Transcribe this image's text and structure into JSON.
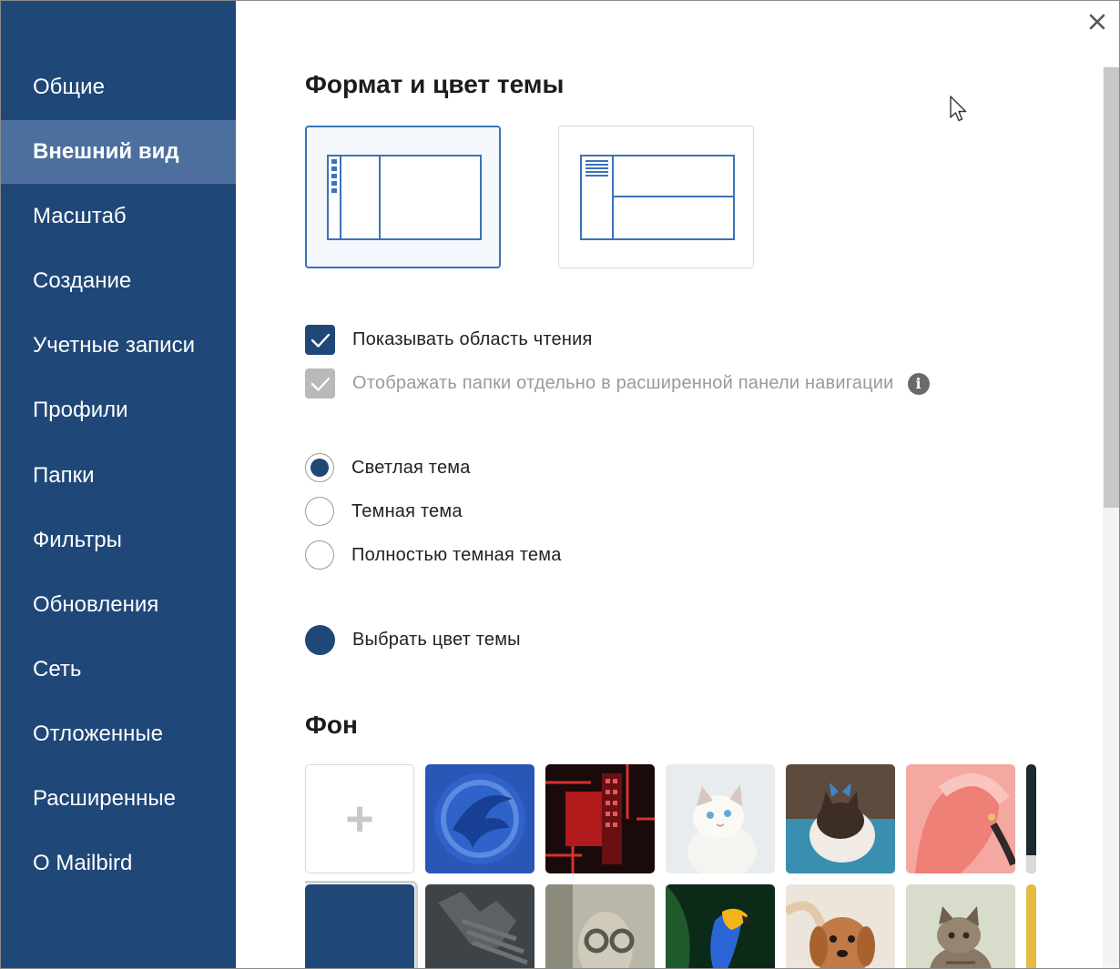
{
  "window": {
    "close_label": "✕"
  },
  "sidebar": {
    "items": [
      {
        "label": "Общие"
      },
      {
        "label": "Внешний вид",
        "active": true
      },
      {
        "label": "Масштаб"
      },
      {
        "label": "Создание"
      },
      {
        "label": "Учетные записи"
      },
      {
        "label": "Профили"
      },
      {
        "label": "Папки"
      },
      {
        "label": "Фильтры"
      },
      {
        "label": "Обновления"
      },
      {
        "label": "Сеть"
      },
      {
        "label": "Отложенные"
      },
      {
        "label": "Расширенные"
      },
      {
        "label": "О Mailbird"
      }
    ]
  },
  "main": {
    "title": "Формат и цвет темы",
    "layouts": [
      {
        "name": "vertical-split",
        "selected": true
      },
      {
        "name": "horizontal-split",
        "selected": false
      }
    ],
    "checkboxes": [
      {
        "label": "Показывать область чтения",
        "checked": true,
        "disabled": false
      },
      {
        "label": "Отображать папки отдельно в расширенной панели навигации",
        "checked": true,
        "disabled": true
      }
    ],
    "themes": [
      {
        "label": "Светлая тема",
        "selected": true
      },
      {
        "label": "Темная тема",
        "selected": false
      },
      {
        "label": "Полностью темная тема",
        "selected": false
      }
    ],
    "theme_color": {
      "label": "Выбрать цвет темы",
      "color": "#1f4778"
    },
    "background_title": "Фон",
    "add_background_label": "+"
  },
  "colors": {
    "sidebar": "#1f4778",
    "sidebar_active": "#4c6f9e",
    "accent": "#3a73b8"
  }
}
